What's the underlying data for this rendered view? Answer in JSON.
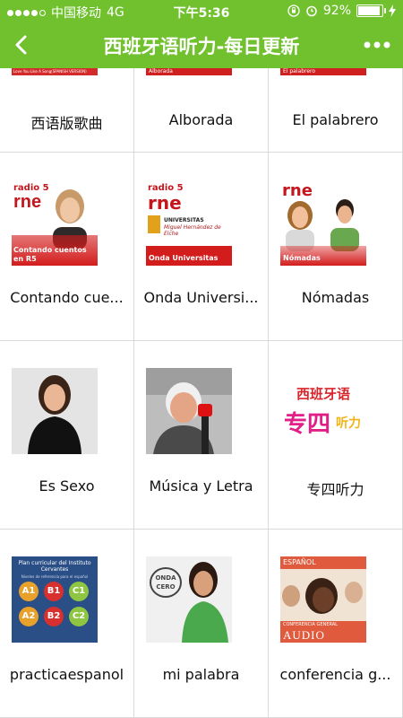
{
  "status_bar": {
    "carrier": "中国移动",
    "network": "4G",
    "time": "下午5:36",
    "battery_percent": "92%",
    "battery_level": 0.92
  },
  "nav": {
    "title": "西班牙语听力-每日更新",
    "back_icon": "chevron-left-icon",
    "more_icon": "more-dots-icon"
  },
  "colors": {
    "brand_green": "#71c12f",
    "rne_red": "#d51b1b"
  },
  "grid": {
    "items": [
      {
        "label": "西语版歌曲"
      },
      {
        "label": "Alborada"
      },
      {
        "label": "El palabrero"
      },
      {
        "label": "Contando cue..."
      },
      {
        "label": "Onda Universi..."
      },
      {
        "label": "Nómadas"
      },
      {
        "label": "Es Sexo"
      },
      {
        "label": "Música y Letra"
      },
      {
        "label": "专四听力"
      },
      {
        "label": "practicaespanol"
      },
      {
        "label": "mi palabra"
      },
      {
        "label": "conferencia g..."
      }
    ]
  },
  "thumbs": {
    "top_left_caption": "Love You Like A Song(SPANISH VERSION)",
    "alborada_caption": "Alborada",
    "palabrero_caption": "El palabrero",
    "radio5": "radio 5",
    "rne": "rne",
    "contando_caption": "Contando cuentos en R5",
    "universitas_line1": "UNIVERSITAS",
    "universitas_line2": "Miguel Hernández de Elche",
    "onda_caption": "Onda Universitas",
    "nomadas_caption": "Nómadas",
    "zhuansi_top": "西班牙语",
    "zhuansi_big": "专四",
    "zhuansi_small": "听力",
    "plan_title": "Plan curricular del Instituto Cervantes",
    "plan_sub": "Niveles de referencia para el español",
    "levels": [
      "A1",
      "B1",
      "C1",
      "A2",
      "B2",
      "C2"
    ],
    "onda_cero_1": "ONDA",
    "onda_cero_2": "CERO",
    "espanol": "ESPAÑOL",
    "conf_general": "CONFERENCIA GENERAL",
    "audio": "AUDIO"
  }
}
